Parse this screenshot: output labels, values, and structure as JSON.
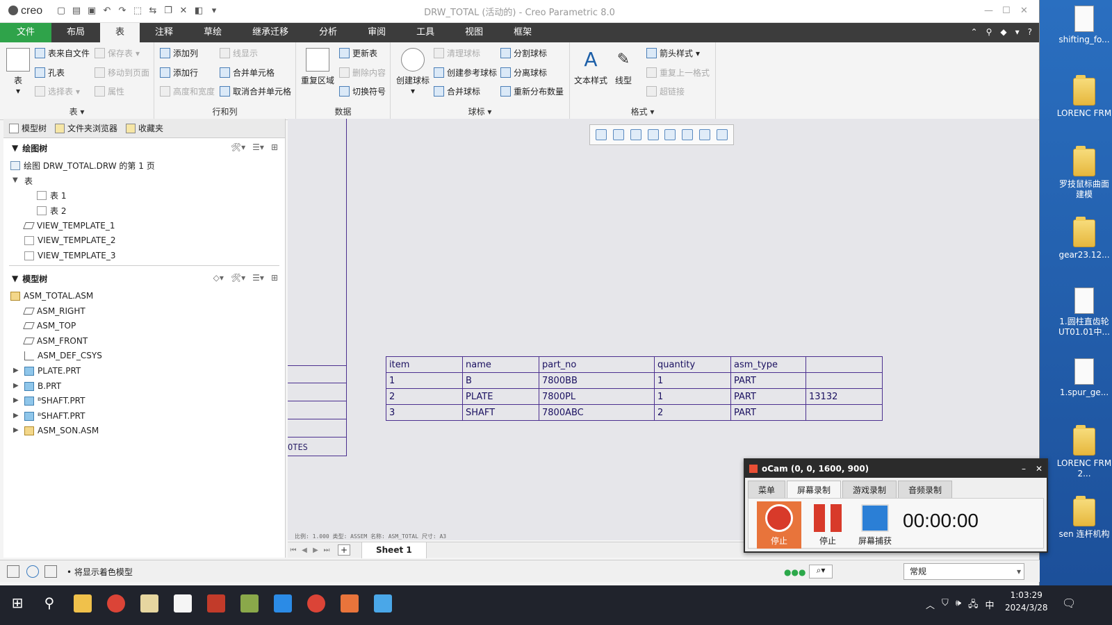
{
  "app": {
    "logo": "creo",
    "window_title": "DRW_TOTAL (活动的) - Creo Parametric 8.0"
  },
  "menu": {
    "tabs": [
      "文件",
      "布局",
      "表",
      "注释",
      "草绘",
      "继承迁移",
      "分析",
      "审阅",
      "工具",
      "视图",
      "框架"
    ],
    "active": "表"
  },
  "ribbon": {
    "table_group": {
      "label": "表",
      "big_button": "表",
      "items": [
        "表来自文件",
        "孔表",
        "选择表",
        "保存表",
        "移动到页面",
        "属性"
      ]
    },
    "rows_cols_group": {
      "label": "行和列",
      "items": [
        "添加列",
        "添加行",
        "高度和宽度",
        "线显示",
        "合并单元格",
        "取消合并单元格"
      ]
    },
    "data_group": {
      "label": "数据",
      "big_button": "重复区域",
      "items": [
        "更新表",
        "删除内容",
        "切换符号"
      ]
    },
    "balloon_group": {
      "label": "球标",
      "big_button": "创建球标",
      "items": [
        "清理球标",
        "创建参考球标",
        "合并球标",
        "分割球标",
        "分离球标",
        "重新分布数量"
      ]
    },
    "format_group": {
      "label": "格式",
      "big_buttons": [
        "文本样式",
        "线型"
      ],
      "items": [
        "箭头样式",
        "重复上一格式",
        "超链接"
      ]
    }
  },
  "panel": {
    "tabs": [
      "模型树",
      "文件夹浏览器",
      "收藏夹"
    ],
    "drawing_tree": {
      "title": "绘图树",
      "sheet": "绘图 DRW_TOTAL.DRW 的第 1 页",
      "tables_node": "表",
      "tables": [
        "表 1",
        "表 2"
      ],
      "views": [
        "VIEW_TEMPLATE_1",
        "VIEW_TEMPLATE_2",
        "VIEW_TEMPLATE_3"
      ]
    },
    "model_tree": {
      "title": "模型树",
      "root": "ASM_TOTAL.ASM",
      "items": [
        "ASM_RIGHT",
        "ASM_TOP",
        "ASM_FRONT",
        "ASM_DEF_CSYS",
        "PLATE.PRT",
        "B.PRT",
        "ᴮSHAFT.PRT",
        "ᴮSHAFT.PRT",
        "ASM_SON.ASM"
      ]
    }
  },
  "drawing": {
    "notes_label": "OTES",
    "status_info": "比例: 1.000   类型: ASSEM   名称: ASM_TOTAL   尺寸: A3",
    "bom": {
      "headers": [
        "item",
        "name",
        "part_no",
        "quantity",
        "asm_type",
        ""
      ],
      "rows": [
        [
          "1",
          "B",
          "7800BB",
          "1",
          "PART",
          ""
        ],
        [
          "2",
          "PLATE",
          "7800PL",
          "1",
          "PART",
          "13132"
        ],
        [
          "3",
          "SHAFT",
          "7800ABC",
          "2",
          "PART",
          ""
        ]
      ]
    }
  },
  "sheetbar": {
    "sheet_tab": "Sheet 1",
    "add": "+"
  },
  "statusbar": {
    "message": "将显示着色模型",
    "filter_value": "常规"
  },
  "ocam": {
    "title": "oCam (0, 0, 1600, 900)",
    "tabs": [
      "菜单",
      "屏幕录制",
      "游戏录制",
      "音频录制"
    ],
    "active_tab": "屏幕录制",
    "buttons": [
      "停止",
      "停止",
      "屏幕捕获"
    ],
    "timer": "00:00:00"
  },
  "desktop": {
    "icons": [
      "shifting_fo...",
      "LORENC FRM",
      "罗技鼠标曲面建模",
      "gear23.12...",
      "1.圆柱直齿轮UT01.01中...",
      "1.spur_ge...",
      "LORENC FRM 2...",
      "sen 连杆机构"
    ]
  },
  "taskbar": {
    "time": "1:03:29",
    "date": "2024/3/28",
    "ime": "中"
  }
}
